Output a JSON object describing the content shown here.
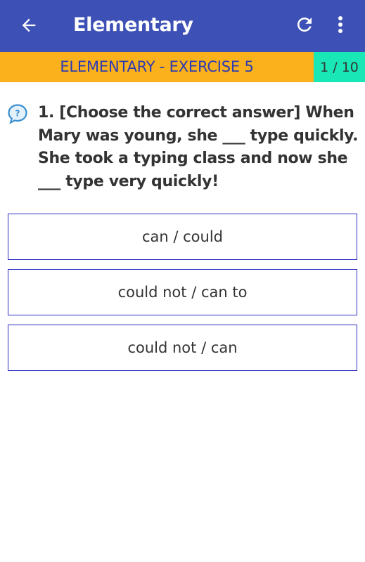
{
  "appbar": {
    "title": "Elementary",
    "back_icon": "arrow-left-icon",
    "refresh_icon": "refresh-icon",
    "more_icon": "more-vertical-icon",
    "color": "#3d50b6"
  },
  "exercise": {
    "title": "ELEMENTARY - EXERCISE 5",
    "counter": "1 / 10",
    "bar_color": "#fbb11b",
    "counter_color": "#19e7b6"
  },
  "question": {
    "icon": "question-bubble-icon",
    "text": "1. [Choose the correct answer] When Mary was young, she ___ type quickly. She took a typing class and now she ___ type very quickly!"
  },
  "options": [
    {
      "label": "can / could"
    },
    {
      "label": "could not / can to"
    },
    {
      "label": "could not / can"
    }
  ]
}
